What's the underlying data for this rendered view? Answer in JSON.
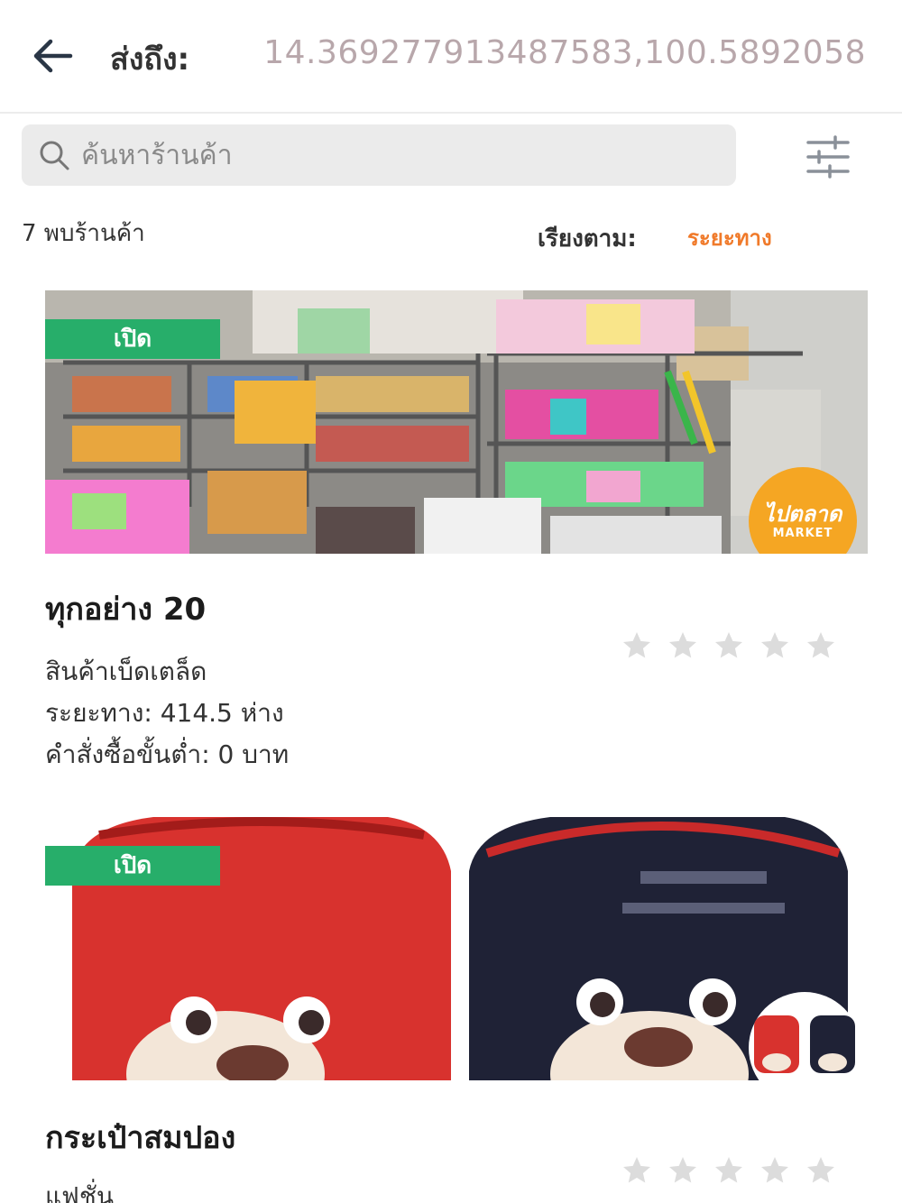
{
  "header": {
    "deliver_label": "ส่งถึง:",
    "coordinates": "14.369277913487583,100.5892058"
  },
  "search": {
    "placeholder": "ค้นหาร้านค้า"
  },
  "results": {
    "count_text": "7 พบร้านค้า",
    "sort_label": "เรียงตาม:",
    "sort_value": "ระยะทาง"
  },
  "colors": {
    "accent_orange": "#f07a2a",
    "status_green": "#27ae6a",
    "coord_gray": "#b8a7ab",
    "star_gray": "#d9d9d9"
  },
  "stores": [
    {
      "status": "เปิด",
      "name": "ทุกอย่าง 20",
      "category": "สินค้าเบ็ดเตล็ด",
      "distance": "ระยะทาง: 414.5 ห่าง",
      "min_order": "คำสั่งซื้อขั้นต่ำ: 0 บาท",
      "logo_line1": "ไปตลาด",
      "logo_line2": "MARKET",
      "rating": 0,
      "stars_total": 5
    },
    {
      "status": "เปิด",
      "name": "กระเป๋าสมปอง",
      "category": "แฟชั่น",
      "rating": 0,
      "stars_total": 5
    }
  ]
}
